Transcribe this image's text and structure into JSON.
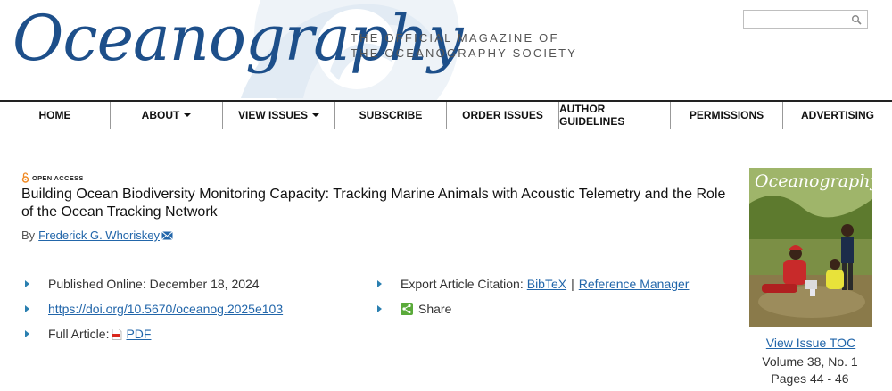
{
  "header": {
    "logo": "Oceanography",
    "tagline_line1": "THE OFFICIAL MAGAZINE OF",
    "tagline_line2": "THE OCEANOGRAPHY SOCIETY",
    "search_value": "",
    "search_icon": "search-icon"
  },
  "nav": {
    "items": [
      {
        "label": "HOME",
        "dropdown": false
      },
      {
        "label": "ABOUT",
        "dropdown": true
      },
      {
        "label": "VIEW ISSUES",
        "dropdown": true
      },
      {
        "label": "SUBSCRIBE",
        "dropdown": false
      },
      {
        "label": "ORDER ISSUES",
        "dropdown": false
      },
      {
        "label": "AUTHOR GUIDELINES",
        "dropdown": false
      },
      {
        "label": "PERMISSIONS",
        "dropdown": false
      },
      {
        "label": "ADVERTISING",
        "dropdown": false
      }
    ]
  },
  "article": {
    "open_access_label": "OPEN ACCESS",
    "title": "Building Ocean Biodiversity Monitoring Capacity: Tracking Marine Animals with Acoustic Telemetry and the Role of the Ocean Tracking Network",
    "by_label": "By",
    "author": "Frederick G. Whoriskey",
    "published": "Published Online: December 18, 2024",
    "doi": "https://doi.org/10.5670/oceanog.2025e103",
    "full_article_label": "Full Article:",
    "pdf_label": "PDF",
    "export_label": "Export Article Citation:",
    "bibtex_label": "BibTeX",
    "separator": "|",
    "reference_manager_label": "Reference Manager",
    "share_label": "Share"
  },
  "sidebar": {
    "cover_title": "Oceanography",
    "view_toc_label": "View Issue TOC",
    "volume": "Volume 38, No. 1",
    "pages": "Pages 44 - 46"
  },
  "colors": {
    "brand_blue": "#1d4f8a",
    "link_blue": "#2266aa",
    "arrow_blue": "#2a7fb0",
    "share_green": "#5aaa3a",
    "open_access_orange": "#f08a24"
  }
}
